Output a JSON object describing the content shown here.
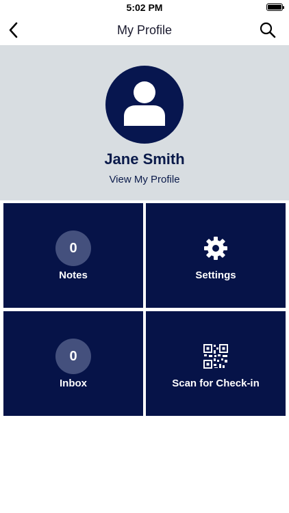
{
  "status_bar": {
    "time": "5:02 PM"
  },
  "nav": {
    "title": "My Profile",
    "back_icon": "chevron-left-icon",
    "search_icon": "search-icon"
  },
  "profile": {
    "name": "Jane Smith",
    "view_link": "View My Profile",
    "avatar_icon": "user-icon",
    "header_bg": "#d8dde1",
    "avatar_bg": "#07164f"
  },
  "tiles": {
    "notes": {
      "count": "0",
      "label": "Notes"
    },
    "settings": {
      "label": "Settings",
      "icon": "gear-icon"
    },
    "inbox": {
      "count": "0",
      "label": "Inbox"
    },
    "scan": {
      "label": "Scan for Check-in",
      "icon": "qr-code-icon"
    }
  },
  "colors": {
    "tile_bg": "#061348",
    "badge_bg": "#44507d",
    "text_dark": "#0a1a4a"
  }
}
